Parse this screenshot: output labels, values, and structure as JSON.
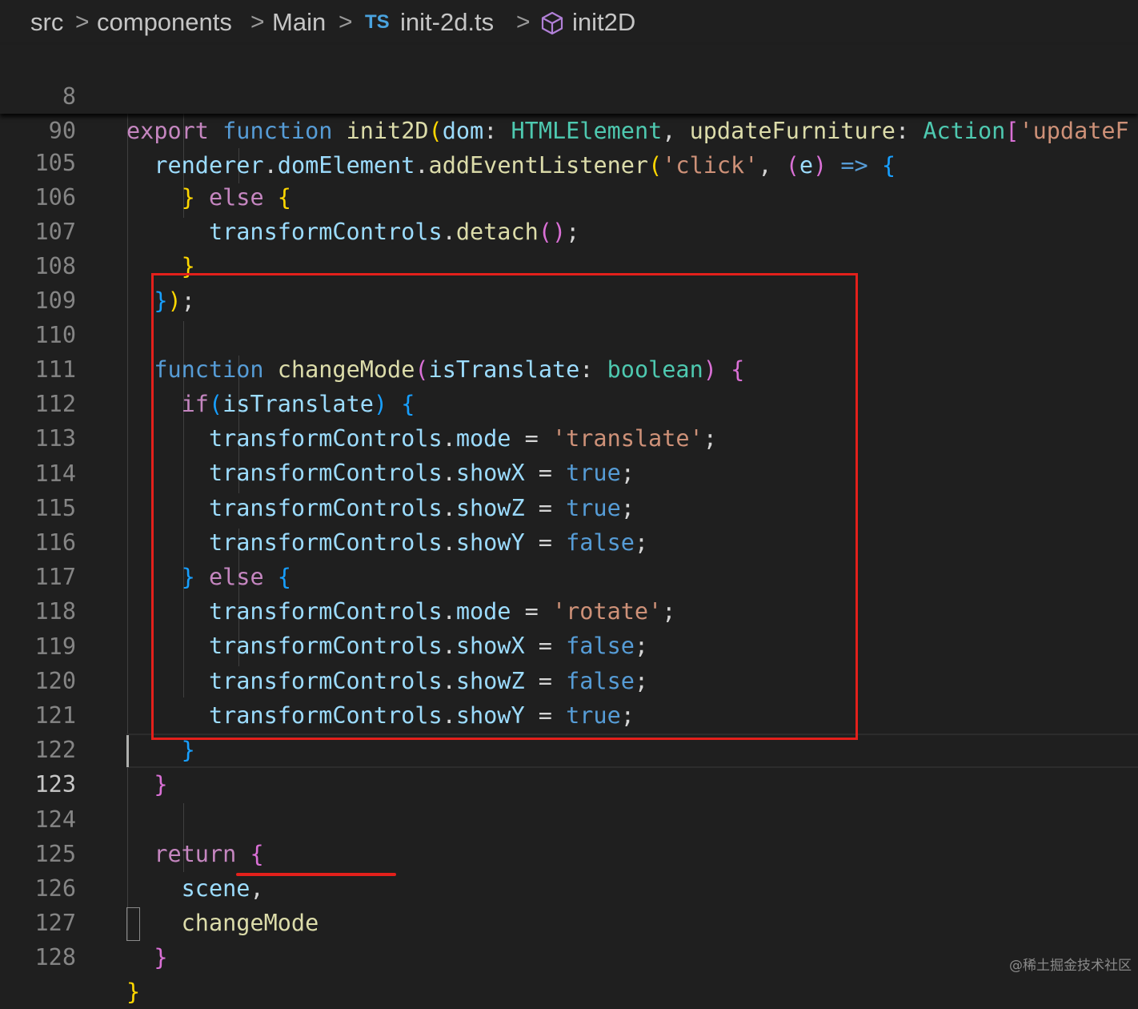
{
  "breadcrumb": {
    "items": [
      "src",
      "components",
      "Main",
      "init-2d.ts",
      "init2D"
    ],
    "separator": ">",
    "ts_badge": "TS",
    "file_icon": "typescript-file-icon",
    "symbol_icon": "cube-symbol-icon"
  },
  "sticky_lines": {
    "l8": {
      "num": "8",
      "t1": "export",
      "t2": "function",
      "t3": "init2D",
      "t4": "(",
      "t5": "dom",
      "t6": ": ",
      "t7": "HTMLElement",
      "t8": ", ",
      "t9": "updateFurniture",
      "t10": ": ",
      "t11": "Action",
      "t12": "[",
      "t13": "'updateF"
    },
    "l90": {
      "num": "90",
      "t1": "renderer",
      "t2": ".",
      "t3": "domElement",
      "t4": ".",
      "t5": "addEventListener",
      "t6": "(",
      "t7": "'click'",
      "t8": ", ",
      "t9": "(",
      "t10": "e",
      "t11": ")",
      "t12": " => ",
      "t13": "{"
    }
  },
  "lines": {
    "l105": {
      "num": "105",
      "t1": "}",
      "t2": " else ",
      "t3": "{"
    },
    "l106": {
      "num": "106",
      "t1": "transformControls",
      "t2": ".",
      "t3": "detach",
      "t4": "()",
      "t5": ";"
    },
    "l107": {
      "num": "107",
      "t1": "}"
    },
    "l108": {
      "num": "108",
      "t1": "}",
      "t2": ")",
      "t3": ";"
    },
    "l109": {
      "num": "109"
    },
    "l110": {
      "num": "110",
      "t1": "function",
      "t2": " ",
      "t3": "changeMode",
      "t4": "(",
      "t5": "isTranslate",
      "t6": ": ",
      "t7": "boolean",
      "t8": ")",
      "t9": " ",
      "t10": "{"
    },
    "l111": {
      "num": "111",
      "t1": "if",
      "t2": "(",
      "t3": "isTranslate",
      "t4": ")",
      "t5": " ",
      "t6": "{"
    },
    "l112": {
      "num": "112",
      "t1": "transformControls",
      "t2": ".",
      "t3": "mode",
      "t4": " = ",
      "t5": "'translate'",
      "t6": ";"
    },
    "l113": {
      "num": "113",
      "t1": "transformControls",
      "t2": ".",
      "t3": "showX",
      "t4": " = ",
      "t5": "true",
      "t6": ";"
    },
    "l114": {
      "num": "114",
      "t1": "transformControls",
      "t2": ".",
      "t3": "showZ",
      "t4": " = ",
      "t5": "true",
      "t6": ";"
    },
    "l115": {
      "num": "115",
      "t1": "transformControls",
      "t2": ".",
      "t3": "showY",
      "t4": " = ",
      "t5": "false",
      "t6": ";"
    },
    "l116": {
      "num": "116",
      "t1": "}",
      "t2": " else ",
      "t3": "{"
    },
    "l117": {
      "num": "117",
      "t1": "transformControls",
      "t2": ".",
      "t3": "mode",
      "t4": " = ",
      "t5": "'rotate'",
      "t6": ";"
    },
    "l118": {
      "num": "118",
      "t1": "transformControls",
      "t2": ".",
      "t3": "showX",
      "t4": " = ",
      "t5": "false",
      "t6": ";"
    },
    "l119": {
      "num": "119",
      "t1": "transformControls",
      "t2": ".",
      "t3": "showZ",
      "t4": " = ",
      "t5": "false",
      "t6": ";"
    },
    "l120": {
      "num": "120",
      "t1": "transformControls",
      "t2": ".",
      "t3": "showY",
      "t4": " = ",
      "t5": "true",
      "t6": ";"
    },
    "l121": {
      "num": "121",
      "t1": "}"
    },
    "l122": {
      "num": "122",
      "t1": "}"
    },
    "l123": {
      "num": "123"
    },
    "l124": {
      "num": "124",
      "t1": "return",
      "t2": " ",
      "t3": "{"
    },
    "l125": {
      "num": "125",
      "t1": "scene",
      "t2": ","
    },
    "l126": {
      "num": "126",
      "t1": "changeMode"
    },
    "l127": {
      "num": "127",
      "t1": "}"
    },
    "l128": {
      "num": "128",
      "t1": "}"
    }
  },
  "watermark": "@稀土掘金技术社区",
  "colors": {
    "background": "#1f1f1f",
    "keyword": "#c586c0",
    "storage": "#569cd6",
    "function": "#dcdcaa",
    "variable": "#9cdcfe",
    "type": "#4ec9b0",
    "string": "#ce9178",
    "annotation_red": "#e3201b"
  }
}
